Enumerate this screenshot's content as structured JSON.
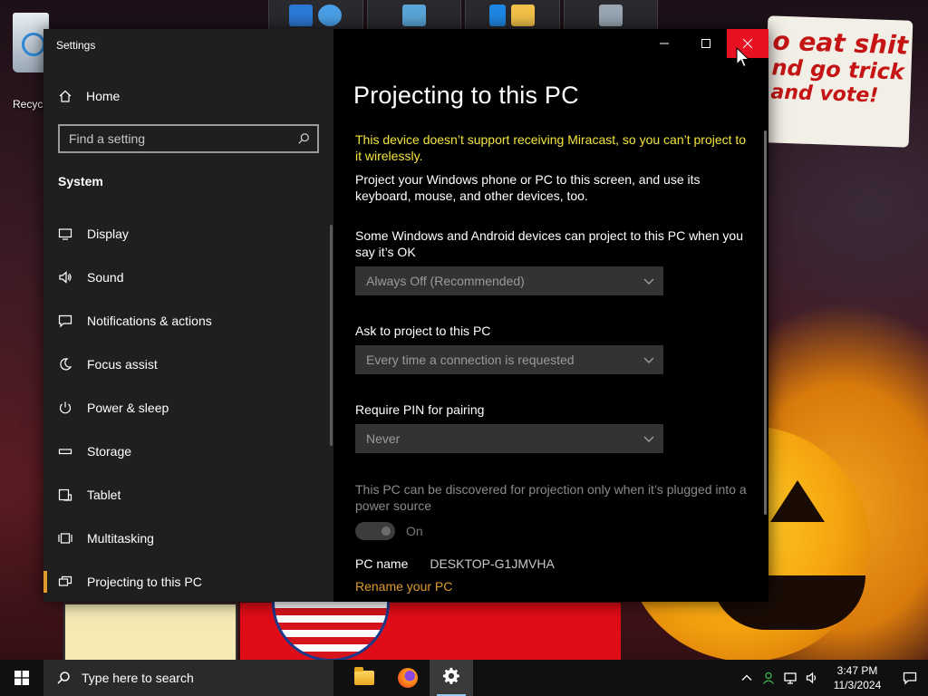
{
  "desktop": {
    "recycle_bin_label": "Recycle Bin",
    "wallpaper_sign": {
      "line1": "o eat shit",
      "line2": "nd go trick",
      "line3": "and vote!"
    }
  },
  "window": {
    "title": "Settings"
  },
  "sidebar": {
    "home_label": "Home",
    "search_placeholder": "Find a setting",
    "section_header": "System",
    "items": [
      {
        "label": "Display",
        "icon": "monitor-icon"
      },
      {
        "label": "Sound",
        "icon": "speaker-icon"
      },
      {
        "label": "Notifications & actions",
        "icon": "message-icon"
      },
      {
        "label": "Focus assist",
        "icon": "moon-icon"
      },
      {
        "label": "Power & sleep",
        "icon": "power-icon"
      },
      {
        "label": "Storage",
        "icon": "storage-icon"
      },
      {
        "label": "Tablet",
        "icon": "tablet-icon"
      },
      {
        "label": "Multitasking",
        "icon": "multitasking-icon"
      },
      {
        "label": "Projecting to this PC",
        "icon": "projecting-icon",
        "selected": true
      }
    ]
  },
  "content": {
    "page_title": "Projecting to this PC",
    "warning": "This device doesn’t support receiving Miracast, so you can’t project to it wirelessly.",
    "intro": "Project your Windows phone or PC to this screen, and use its keyboard, mouse, and other devices, too.",
    "availability": {
      "label": "Some Windows and Android devices can project to this PC when you say it’s OK",
      "value": "Always Off (Recommended)"
    },
    "ask_to_project": {
      "label": "Ask to project to this PC",
      "value": "Every time a connection is requested"
    },
    "require_pin": {
      "label": "Require PIN for pairing",
      "value": "Never"
    },
    "power_note": "This PC can be discovered for projection only when it’s plugged into a power source",
    "power_toggle": {
      "label": "On",
      "state": "on",
      "disabled": true
    },
    "pc_name_label": "PC name",
    "pc_name_value": "DESKTOP-G1JMVHA",
    "rename_link": "Rename your PC",
    "accent_color": "#e09a2e",
    "warning_color": "#f4e43c"
  },
  "taskbar": {
    "search_placeholder": "Type here to search",
    "apps": [
      {
        "name": "file-explorer-icon"
      },
      {
        "name": "firefox-icon"
      },
      {
        "name": "settings-gear-icon",
        "active": true
      }
    ],
    "clock_time": "3:47 PM",
    "clock_date": "11/3/2024"
  }
}
